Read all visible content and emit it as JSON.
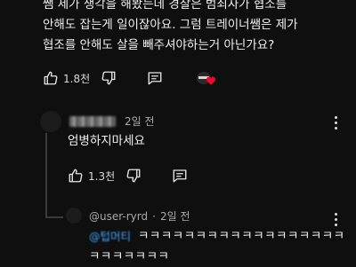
{
  "comment1": {
    "lines": [
      "쌤 제가 생각을 해봤는데 경찰은 범죄자가 협소를",
      "안해도 잡는게 일이잖아요. 그럼 트레이너쌤은 제가",
      "협조를 안해도 살을 빼주셔야하는거 아닌가요?"
    ],
    "like_count": "1.8천"
  },
  "reply1": {
    "time": "2일 전",
    "text": "엄병하지마세요",
    "like_count": "1.3천"
  },
  "reply2": {
    "username": "@user-ryrd",
    "time": "2일 전",
    "mention": "@텁머티",
    "line1": "ㅋㅋㅋㅋㅋㅋㅋㅋㅋㅋㅋㅋㅋㅋㅋㅋㅋㅋ",
    "line2": "ㅋㅋㅋㅋㅋㅋㅋ"
  },
  "colors": {
    "background": "#0f0f0f",
    "text": "#f1f1f1",
    "muted": "#aaaaaa",
    "mention": "#3ea6ff",
    "heart": "#ff0033"
  },
  "icons": [
    "thumbs-up-icon",
    "thumbs-down-icon",
    "reply-icon",
    "creator-heart-icon",
    "more-vert-icon",
    "avatar"
  ]
}
